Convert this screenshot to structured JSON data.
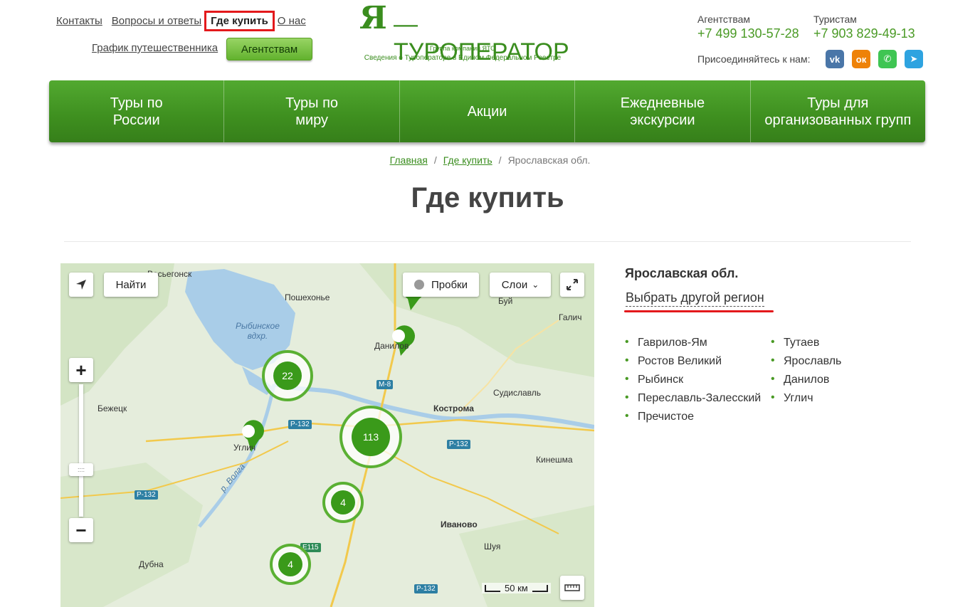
{
  "top_links": [
    "Контакты",
    "Вопросы и ответы",
    "Где купить",
    "О нас"
  ],
  "travel_link": "График путешественника",
  "agent_button": "Агентствам",
  "logo": {
    "mark": "Я",
    "name": "—ТУРОПЕРАТОР",
    "sub1": "Группа компаний ЯТО",
    "sub2": "Сведения о Туроператоре в Едином Федеральном Реестре"
  },
  "contacts": {
    "agencies_label": "Агентствам",
    "agencies_phone": "+7 499 130-57-28",
    "tourists_label": "Туристам",
    "tourists_phone": "+7 903 829-49-13",
    "join_label": "Присоединяйтесь к нам:",
    "social": [
      {
        "name": "vk",
        "glyph": "vk",
        "color": "#4a76a8"
      },
      {
        "name": "ok",
        "glyph": "ок",
        "color": "#ee8208"
      },
      {
        "name": "whatsapp",
        "glyph": "✆",
        "color": "#3fc553"
      },
      {
        "name": "telegram",
        "glyph": "➤",
        "color": "#2ea3e0"
      }
    ]
  },
  "nav": [
    "Туры по\nРоссии",
    "Туры по\nмиру",
    "Акции",
    "Ежедневные\nэкскурсии",
    "Туры для\nорганизованных групп"
  ],
  "breadcrumbs": {
    "home": "Главная",
    "where": "Где купить",
    "current": "Ярославская обл."
  },
  "page_title": "Где купить",
  "map": {
    "find_button": "Найти",
    "traffic_button": "Пробки",
    "layers_button": "Слои",
    "scale": "50 км",
    "labels": [
      {
        "text": "Весьегонск",
        "cls": "l1"
      },
      {
        "text": "Пошехонье",
        "cls": "l2"
      },
      {
        "text": "Буй",
        "cls": "l3"
      },
      {
        "text": "Галич",
        "cls": "l4"
      },
      {
        "text": "Рыбинское\nвдхр.",
        "cls": "l5"
      },
      {
        "text": "Данилов",
        "cls": "l6"
      },
      {
        "text": "Судиславль",
        "cls": "l7"
      },
      {
        "text": "Кострома",
        "cls": "l8"
      },
      {
        "text": "Бежецк",
        "cls": "l9"
      },
      {
        "text": "Углич",
        "cls": "l10"
      },
      {
        "text": "Кинешма",
        "cls": "l11"
      },
      {
        "text": "Иваново",
        "cls": "l12"
      },
      {
        "text": "Шуя",
        "cls": "l13"
      },
      {
        "text": "Дубна",
        "cls": "l14"
      },
      {
        "text": "р. Волга",
        "cls": "l15"
      }
    ],
    "roads": [
      "М-8",
      "Р-132",
      "Р-132",
      "Р-132",
      "Е115",
      "Р-132"
    ],
    "clusters": [
      "22",
      "113",
      "4",
      "4"
    ]
  },
  "region_title": "Ярославская обл.",
  "change_region": "Выбрать другой регион",
  "cities_col1": [
    "Гаврилов-Ям",
    "Ростов Великий",
    "Рыбинск",
    "Переславль-Залесский",
    "Пречистое"
  ],
  "cities_col2": [
    "Тутаев",
    "Ярославль",
    "Данилов",
    "Углич"
  ]
}
